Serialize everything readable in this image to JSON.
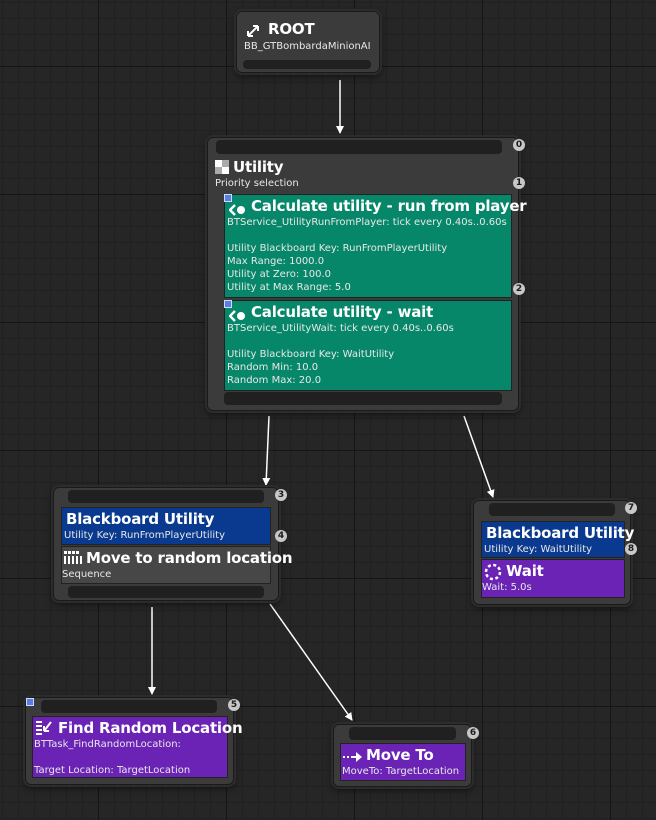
{
  "root": {
    "title": "ROOT",
    "subtitle": "BB_GTBombardaMinionAI",
    "icon": "root-branch-icon"
  },
  "utility": {
    "title": "Utility",
    "subtitle": "Priority selection",
    "icon": "utility-selector-icon",
    "index": "0",
    "index2": "1",
    "index3": "2",
    "services": [
      {
        "title": "Calculate utility - run from player",
        "subtitle": "BTService_UtilityRunFromPlayer: tick every 0.40s..0.60s",
        "key": "Utility Blackboard Key: RunFromPlayerUtility",
        "p1": "Max Range: 1000.0",
        "p2": "Utility at Zero: 100.0",
        "p3": "Utility at Max Range: 5.0"
      },
      {
        "title": "Calculate utility - wait",
        "subtitle": "BTService_UtilityWait: tick every 0.40s..0.60s",
        "key": "Utility Blackboard Key: WaitUtility",
        "p1": "Random Min: 10.0",
        "p2": "Random Max: 20.0"
      }
    ]
  },
  "left_branch": {
    "index": "3",
    "index2": "4",
    "decorator": {
      "title": "Blackboard Utility",
      "subtitle": "Utility Key: RunFromPlayerUtility"
    },
    "composite": {
      "title": "Move to random location",
      "subtitle": "Sequence",
      "icon": "sequence-icon"
    }
  },
  "right_branch": {
    "index": "7",
    "index2": "8",
    "decorator": {
      "title": "Blackboard Utility",
      "subtitle": "Utility Key: WaitUtility"
    },
    "task": {
      "title": "Wait",
      "subtitle": "Wait: 5.0s",
      "icon": "wait-icon"
    }
  },
  "find_random": {
    "index": "5",
    "title": "Find Random Location",
    "subtitle": "BTTask_FindRandomLocation:",
    "param": "Target Location: TargetLocation",
    "icon": "find-location-icon"
  },
  "move_to": {
    "index": "6",
    "title": "Move To",
    "subtitle": "MoveTo: TargetLocation",
    "icon": "move-to-icon"
  },
  "colors": {
    "service": "#07876a",
    "decorator": "#0a3a8f",
    "task": "#6a23b5",
    "composite": "#474747",
    "background": "#262626"
  }
}
